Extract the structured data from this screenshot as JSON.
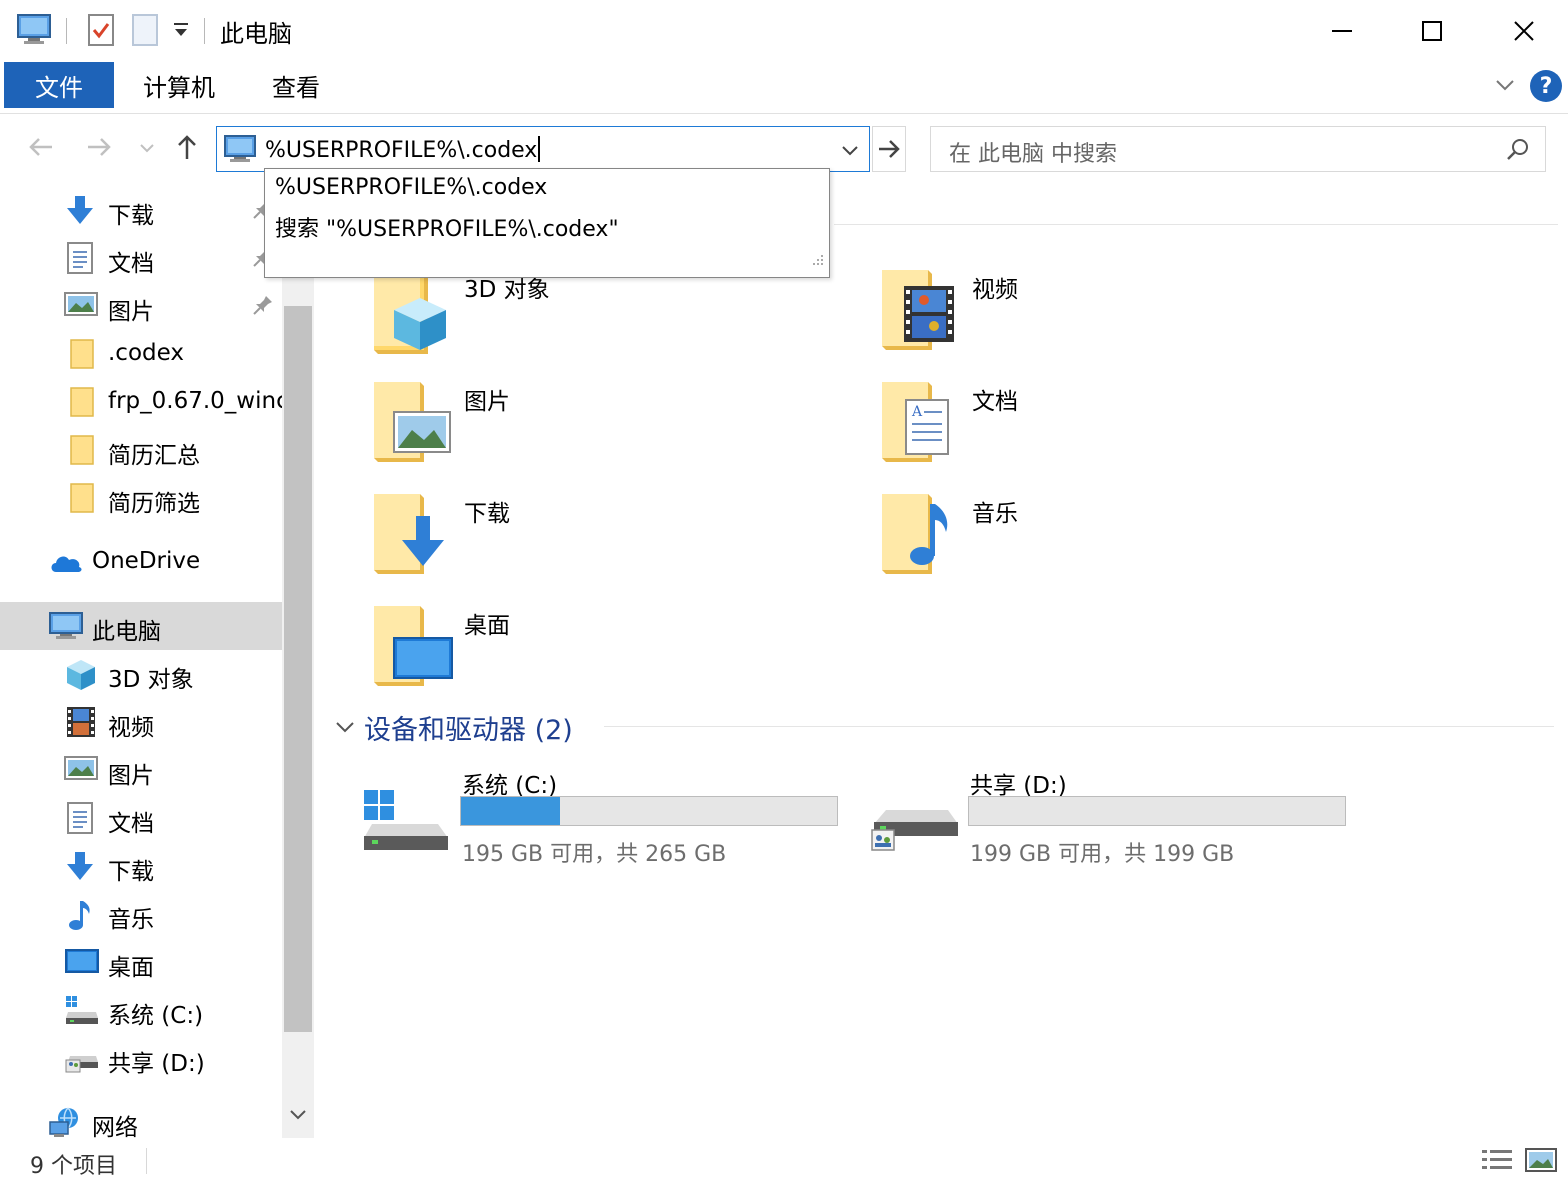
{
  "window": {
    "title": "此电脑"
  },
  "ribbon": {
    "tabs": [
      {
        "label": "文件"
      },
      {
        "label": "计算机"
      },
      {
        "label": "查看"
      }
    ],
    "help_label": "?"
  },
  "address_bar": {
    "value": "%USERPROFILE%\\.codex"
  },
  "autocomplete": {
    "items": [
      {
        "label": "%USERPROFILE%\\.codex"
      },
      {
        "label": "搜索 \"%USERPROFILE%\\.codex\""
      }
    ]
  },
  "search": {
    "placeholder": "在 此电脑 中搜索"
  },
  "sidebar": {
    "items": [
      {
        "label": "下载",
        "icon": "download-arrow-icon",
        "pinned": true
      },
      {
        "label": "文档",
        "icon": "document-icon",
        "pinned": true
      },
      {
        "label": "图片",
        "icon": "picture-icon",
        "pinned": true
      },
      {
        "label": ".codex",
        "icon": "folder-icon"
      },
      {
        "label": "frp_0.67.0_winc",
        "icon": "folder-icon"
      },
      {
        "label": "简历汇总",
        "icon": "folder-icon"
      },
      {
        "label": "简历筛选",
        "icon": "folder-icon"
      },
      {
        "label": "OneDrive",
        "icon": "cloud-icon"
      },
      {
        "label": "此电脑",
        "icon": "computer-icon",
        "selected": true
      },
      {
        "label": "3D 对象",
        "icon": "cube-icon"
      },
      {
        "label": "视频",
        "icon": "film-icon"
      },
      {
        "label": "图片",
        "icon": "picture-icon"
      },
      {
        "label": "文档",
        "icon": "document-icon"
      },
      {
        "label": "下载",
        "icon": "download-arrow-icon"
      },
      {
        "label": "音乐",
        "icon": "music-note-icon"
      },
      {
        "label": "桌面",
        "icon": "desktop-icon"
      },
      {
        "label": "系统 (C:)",
        "icon": "system-drive-icon"
      },
      {
        "label": "共享 (D:)",
        "icon": "network-drive-icon"
      },
      {
        "label": "网络",
        "icon": "network-icon"
      }
    ]
  },
  "folders": [
    {
      "label": "3D 对象",
      "icon": "cube-folder-icon"
    },
    {
      "label": "视频",
      "icon": "video-folder-icon"
    },
    {
      "label": "图片",
      "icon": "pictures-folder-icon"
    },
    {
      "label": "文档",
      "icon": "documents-folder-icon"
    },
    {
      "label": "下载",
      "icon": "downloads-folder-icon"
    },
    {
      "label": "音乐",
      "icon": "music-folder-icon"
    },
    {
      "label": "桌面",
      "icon": "desktop-folder-icon"
    }
  ],
  "devices_group": {
    "title": "设备和驱动器 (2)"
  },
  "drives": [
    {
      "name": "系统 (C:)",
      "info": "195 GB 可用，共 265 GB",
      "used_fraction": 0.264
    },
    {
      "name": "共享 (D:)",
      "info": "199 GB 可用，共 199 GB",
      "used_fraction": 0.0
    }
  ],
  "status": {
    "item_count": "9 个项目"
  },
  "colors": {
    "accent": "#1e63b8",
    "selection": "#d9d9d9",
    "drive_fill": "#3a96dd",
    "group_title": "#1e3f8f"
  }
}
